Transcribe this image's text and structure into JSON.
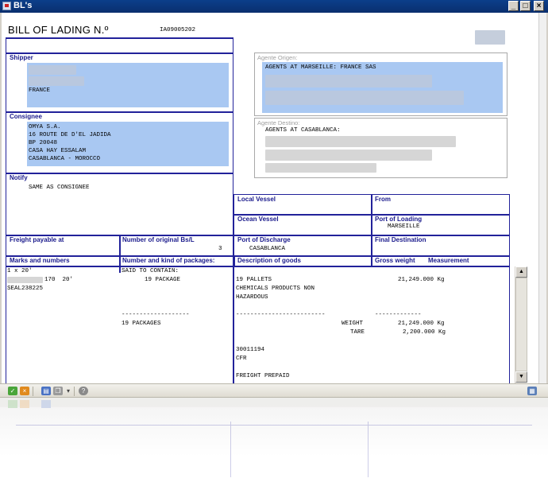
{
  "window": {
    "title": "BL's",
    "minimize": "_",
    "maximize": "□",
    "close": "×"
  },
  "bl": {
    "title": "BILL OF LADING N.º",
    "number": "IA09005202"
  },
  "shipper": {
    "label": "Shipper",
    "country": "FRANCE"
  },
  "consignee": {
    "label": "Consignee",
    "lines": [
      "OMYA S.A.",
      "16 ROUTE DE D'EL JADIDA",
      "BP 20048",
      "CASA HAY ESSALAM",
      "CASABLANCA - MOROCCO"
    ]
  },
  "notify": {
    "label": "Notify",
    "value": "SAME AS CONSIGNEE"
  },
  "agente_origen": {
    "label": "Agente Origen:",
    "value": "AGENTS AT MARSEILLE: FRANCE SAS"
  },
  "agente_destino": {
    "label": "Agente Destino:",
    "value": "AGENTS AT CASABLANCA:"
  },
  "local_vessel": {
    "label": "Local Vessel",
    "value": ""
  },
  "from": {
    "label": "From",
    "value": ""
  },
  "ocean_vessel": {
    "label": "Ocean Vessel",
    "value": ""
  },
  "port_of_loading": {
    "label": "Port of Loading",
    "value": "MARSEILLE"
  },
  "freight_payable": {
    "label": "Freight payable at",
    "value": ""
  },
  "original_bsl": {
    "label": "Number of original Bs/L",
    "value": "3"
  },
  "port_of_discharge": {
    "label": "Port of Discharge",
    "value": "CASABLANCA"
  },
  "final_destination": {
    "label": "Final Destination",
    "value": ""
  },
  "headers": {
    "marks": "Marks and numbers",
    "packages": "Number and kind of packages:",
    "description": "Description of goods",
    "gross": "Gross weight",
    "measurement": "Measurement"
  },
  "body": {
    "marks": [
      "1 x 20'",
      "170  20'",
      "SEAL238225"
    ],
    "said_to_contain": "SAID TO CONTAIN:",
    "package_line": "19 PACKAGE",
    "desc_lines": [
      "19 PALLETS",
      "CHEMICALS PRODUCTS NON",
      "HAZARDOUS"
    ],
    "gross_weight": "21,249.000 Kg",
    "dashes_a": "-------------------",
    "dashes_b": "-------------------------",
    "dashes_c": "-------------",
    "total_packages": "19 PACKAGES",
    "weight_label": "WEIGHT",
    "weight_value": "21,249.000 Kg",
    "tare_label": "TARE",
    "tare_value": "2,200.000 Kg",
    "ref_number": "30011194",
    "incoterm": "CFR",
    "freight": "FREIGHT PREPAID"
  },
  "scroll": {
    "up": "▲",
    "down": "▼"
  },
  "toolbar": {
    "accept": "✓",
    "cancel": "×",
    "print": "▤",
    "copy": "❐",
    "dropdown": "▾",
    "help": "?",
    "view": "▦"
  },
  "colors": {
    "border": "#22229a",
    "highlight": "#a9c8f2",
    "title_bar": "#0b3f8a"
  }
}
